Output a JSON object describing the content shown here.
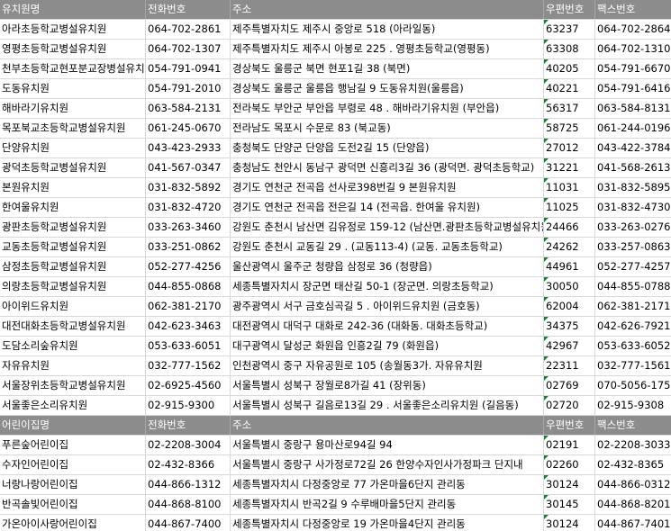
{
  "kindergarten_header": {
    "name": "유치원명",
    "phone": "전화번호",
    "address": "주소",
    "zip": "우편번호",
    "fax": "팩스번호"
  },
  "kindergartens": [
    {
      "name": "아라초등학교병설유치원",
      "phone": "064-702-2861",
      "address": "제주특별자치도 제주시 중앙로 518 (아라일동)",
      "zip": "63237",
      "fax": "064-702-2864"
    },
    {
      "name": "영평초등학교병설유치원",
      "phone": "064-702-1307",
      "address": "제주특별자치도 제주시 아봉로 225 . 영평초등학교(영평동)",
      "zip": "63308",
      "fax": "064-702-1310"
    },
    {
      "name": "천부초등학교현포분교장병설유치원",
      "phone": "054-791-0941",
      "address": "경상북도 울릉군 북면 현포1길 38 (북면)",
      "zip": "40205",
      "fax": "054-791-6670"
    },
    {
      "name": "도동유치원",
      "phone": "054-791-2010",
      "address": "경상북도 울릉군 울릉읍 행남길 9 도동유치원(울릉읍)",
      "zip": "40221",
      "fax": "054-791-6416"
    },
    {
      "name": "해바라기유치원",
      "phone": "063-584-2131",
      "address": "전라북도 부안군 부안읍 부령로 48 . 해바라기유치원 (부안읍)",
      "zip": "56317",
      "fax": "063-584-8131"
    },
    {
      "name": "목포북교초등학교병설유치원",
      "phone": "061-245-0670",
      "address": "전라남도 목포시 수문로 83 (북교동)",
      "zip": "58725",
      "fax": "061-244-0196"
    },
    {
      "name": "단양유치원",
      "phone": "043-423-2933",
      "address": "충청북도 단양군 단양읍 도전2길 15 (단양읍)",
      "zip": "27012",
      "fax": "043-422-3784"
    },
    {
      "name": "광덕초등학교병설유치원",
      "phone": "041-567-0347",
      "address": "충청남도 천안시 동남구 광덕면 신흥리3길 36 (광덕면. 광덕초등학교)",
      "zip": "31221",
      "fax": "041-568-2613"
    },
    {
      "name": "본원유치원",
      "phone": "031-832-5892",
      "address": "경기도 연천군 전곡읍 선사로398번길 9 본원유치원",
      "zip": "11031",
      "fax": "031-832-5895"
    },
    {
      "name": "한여울유치원",
      "phone": "031-832-4720",
      "address": "경기도 연천군 전곡읍 전은길 14 (전곡읍. 한여울 유치원)",
      "zip": "11025",
      "fax": "031-832-4730"
    },
    {
      "name": "광판초등학교병설유치원",
      "phone": "033-263-3460",
      "address": "강원도 춘천시 남산면 김유정로 159-12 (남산면.광판초등학교병설유치원)",
      "zip": "24466",
      "fax": "033-263-0276"
    },
    {
      "name": "교동초등학교병설유치원",
      "phone": "033-251-0862",
      "address": "강원도 춘천시 교동길 29 . (교동113-4) (교동. 교동초등학교)",
      "zip": "24262",
      "fax": "033-257-0863"
    },
    {
      "name": "삼정초등학교병설유치원",
      "phone": "052-277-4256",
      "address": "울산광역시 울주군 청량읍 삼정로 36 (청량읍)",
      "zip": "44961",
      "fax": "052-277-4257"
    },
    {
      "name": "의랑초등학교병설유치원",
      "phone": "044-855-0868",
      "address": "세종특별자치시 장군면 태산길 50-1 (장군면. 의랑초등학교)",
      "zip": "30050",
      "fax": "044-855-0788"
    },
    {
      "name": "아이위드유치원",
      "phone": "062-381-2170",
      "address": "광주광역시 서구 금호심곡길 5 . 아이위드유치원 (금호동)",
      "zip": "62004",
      "fax": "062-381-2171"
    },
    {
      "name": "대전대화초등학교병설유치원",
      "phone": "042-623-3463",
      "address": "대전광역시 대덕구 대화로 242-36 (대화동. 대화초등학교)",
      "zip": "34375",
      "fax": "042-626-7921"
    },
    {
      "name": "도담소리숲유치원",
      "phone": "053-633-6051",
      "address": "대구광역시 달성군 화원읍 인흥2길 79 (화원읍)",
      "zip": "42967",
      "fax": "053-633-6052"
    },
    {
      "name": "자유유치원",
      "phone": "032-777-1562",
      "address": "인천광역시 중구 자유공원로 105 (송월동3가. 자유유치원",
      "zip": "22311",
      "fax": "032-777-1561"
    },
    {
      "name": "서울장위초등학교병설유치원",
      "phone": "02-6925-4560",
      "address": "서울특별시 성북구 장월로8가길 41 (장위동)",
      "zip": "02769",
      "fax": "070-5056-1758"
    },
    {
      "name": "서울좋은소리유치원",
      "phone": "02-915-9300",
      "address": "서울특별시 성북구 길음로13길 29 . 서울좋은소리유치원 (길음동)",
      "zip": "02720",
      "fax": "02-915-9308"
    }
  ],
  "daycare_header": {
    "name": "어린이집명",
    "phone": "전화번호",
    "address": "주소",
    "zip": "우편번호",
    "fax": "팩스번호"
  },
  "daycares": [
    {
      "name": "푸른숲어린이집",
      "phone": "02-2208-3004",
      "address": "서울특별시 중랑구 용마산로94길 94",
      "zip": "02191",
      "fax": "02-2208-3033"
    },
    {
      "name": "수자인어린이집",
      "phone": "02-432-8366",
      "address": "서울특별시 중랑구 사가정로72길 26 한양수자인사가정파크 단지내",
      "zip": "02260",
      "fax": "02-432-8365"
    },
    {
      "name": "너랑나랑어린이집",
      "phone": "044-866-1312",
      "address": "세종특별자치시 다정중앙로 77 가온마을6단지 관리동",
      "zip": "30124",
      "fax": "044-866-0312"
    },
    {
      "name": "반곡솔빛어린이집",
      "phone": "044-868-8100",
      "address": "세종특별자치시 반곡2길 9 수루배마을5단지 관리동",
      "zip": "30145",
      "fax": "044-868-8201"
    },
    {
      "name": "가온아이사랑어린이집",
      "phone": "044-867-7400",
      "address": "세종특별자치시 다정중앙로 19 가온마을4단지 관리동",
      "zip": "30124",
      "fax": "044-867-7401"
    }
  ]
}
